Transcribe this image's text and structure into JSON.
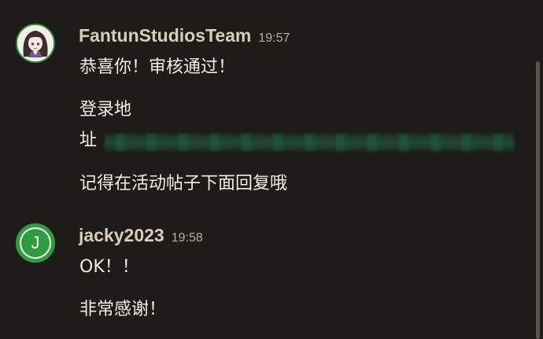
{
  "messages": [
    {
      "username": "FantunStudiosTeam",
      "time": "19:57",
      "lines": [
        "恭喜你！审核通过！",
        "登录地",
        "址",
        "记得在活动帖子下面回复哦"
      ]
    },
    {
      "username": "jacky2023",
      "time": "19:58",
      "avatar_letter": "J",
      "lines": [
        "OK！！",
        "非常感谢！"
      ]
    }
  ],
  "colors": {
    "background": "#1f1b18",
    "username": "#d8cdbb",
    "avatar_green": "#2f9c3f"
  }
}
